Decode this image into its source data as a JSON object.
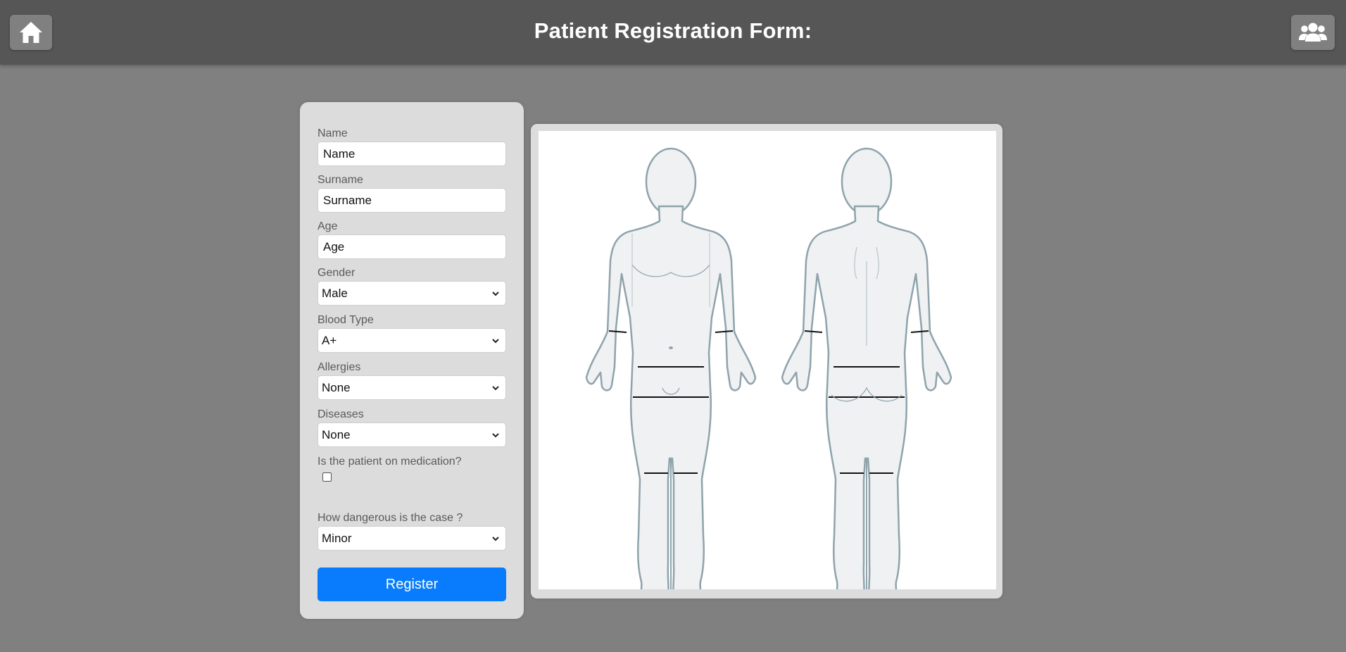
{
  "header": {
    "title": "Patient Registration Form:",
    "home_icon": "home-icon",
    "users_icon": "users-icon"
  },
  "form": {
    "name": {
      "label": "Name",
      "value": "Name"
    },
    "surname": {
      "label": "Surname",
      "value": "Surname"
    },
    "age": {
      "label": "Age",
      "value": "Age"
    },
    "gender": {
      "label": "Gender",
      "value": "Male"
    },
    "blood_type": {
      "label": "Blood Type",
      "value": "A+"
    },
    "allergies": {
      "label": "Allergies",
      "value": "None"
    },
    "diseases": {
      "label": "Diseases",
      "value": "None"
    },
    "medication": {
      "label": "Is the patient on medication?",
      "checked": false
    },
    "danger": {
      "label": "How dangerous is the case ?",
      "value": "Minor"
    },
    "register_label": "Register"
  },
  "body_diagram": {
    "views": [
      "front",
      "back"
    ]
  },
  "colors": {
    "header_bg": "#575657",
    "page_bg": "#808080",
    "card_bg": "#dcdcdc",
    "primary": "#087cfc",
    "body_fill": "#eff1f2",
    "body_stroke": "#8fa3ac"
  }
}
